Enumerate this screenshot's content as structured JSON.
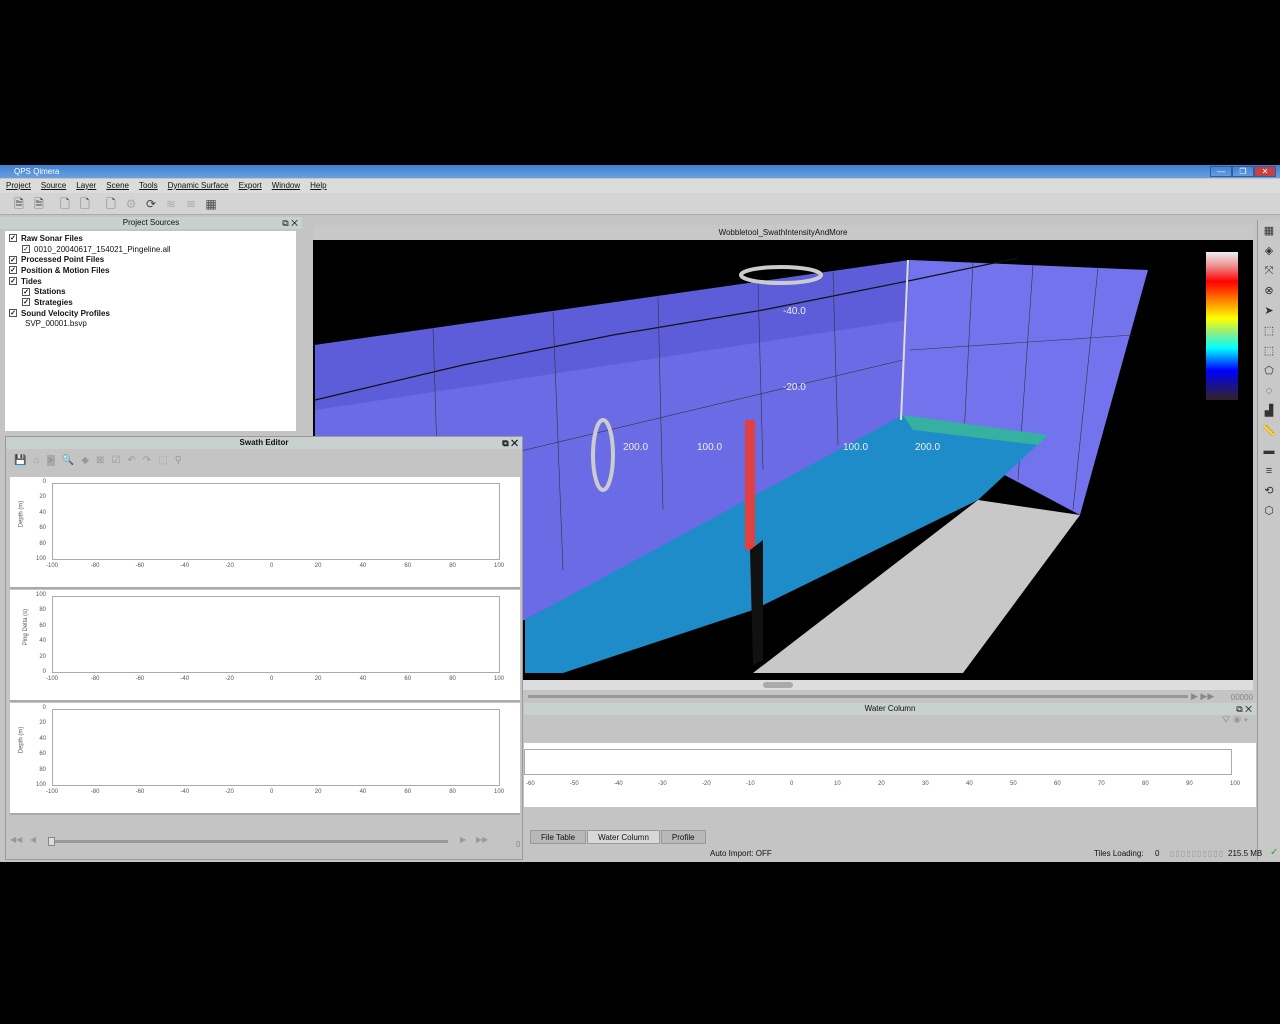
{
  "window": {
    "title": "QPS Qimera",
    "min": "—",
    "max": "❐",
    "close": "✕"
  },
  "menu": [
    "Project",
    "Source",
    "Layer",
    "Scene",
    "Tools",
    "Dynamic Surface",
    "Export",
    "Window",
    "Help"
  ],
  "sources": {
    "title": "Project Sources",
    "items": [
      {
        "label": "Raw Sonar Files",
        "level": 0,
        "checked": true
      },
      {
        "label": "0010_20040617_154021_Pingeline.all",
        "level": 1,
        "checked": true
      },
      {
        "label": "Processed Point Files",
        "level": 0,
        "checked": true
      },
      {
        "label": "Position & Motion Files",
        "level": 0,
        "checked": true
      },
      {
        "label": "Tides",
        "level": 0,
        "checked": true
      },
      {
        "label": "Stations",
        "level": 1,
        "checked": true
      },
      {
        "label": "Strategies",
        "level": 1,
        "checked": true
      },
      {
        "label": "Sound Velocity Profiles",
        "level": 0,
        "checked": true
      },
      {
        "label": "SVP_00001.bsvp",
        "level": 1,
        "checked": null
      }
    ]
  },
  "swath": {
    "title": "Swath Editor",
    "charts": [
      {
        "ylabel": "Depth (m)",
        "yticks": [
          "0",
          "20",
          "40",
          "60",
          "80",
          "100"
        ]
      },
      {
        "ylabel": "Ping Delta (s)",
        "yticks": [
          "100",
          "80",
          "60",
          "40",
          "20",
          "0"
        ]
      },
      {
        "ylabel": "Depth (m)",
        "yticks": [
          "0",
          "20",
          "40",
          "60",
          "80",
          "100"
        ]
      }
    ],
    "xticks": [
      "-100",
      "-80",
      "-60",
      "-40",
      "-20",
      "0",
      "20",
      "40",
      "60",
      "80",
      "100"
    ],
    "counter": "0"
  },
  "view": {
    "title": "Wobbletool_SwathIntensityAndMore",
    "labels": [
      "-40.0",
      "-20.0",
      "200.0",
      "100.0",
      "100.0",
      "200.0"
    ],
    "counter": "00000"
  },
  "watercolumn": {
    "title": "Water Column",
    "xticks": [
      "-60",
      "-50",
      "-40",
      "-30",
      "-20",
      "-10",
      "0",
      "10",
      "20",
      "30",
      "40",
      "50",
      "60",
      "70",
      "80",
      "90",
      "100"
    ]
  },
  "tabs": [
    "File Table",
    "Water Column",
    "Profile"
  ],
  "active_tab": "Water Column",
  "status": {
    "auto_import": "Auto Import: OFF",
    "tiles_label": "Tiles Loading:",
    "tiles": "0",
    "memory": "215.5 MB",
    "check": "✓"
  },
  "colors": {
    "wall": "#6d6de8",
    "seafloor": "#1e8cc8",
    "title": "#4a86d8"
  }
}
